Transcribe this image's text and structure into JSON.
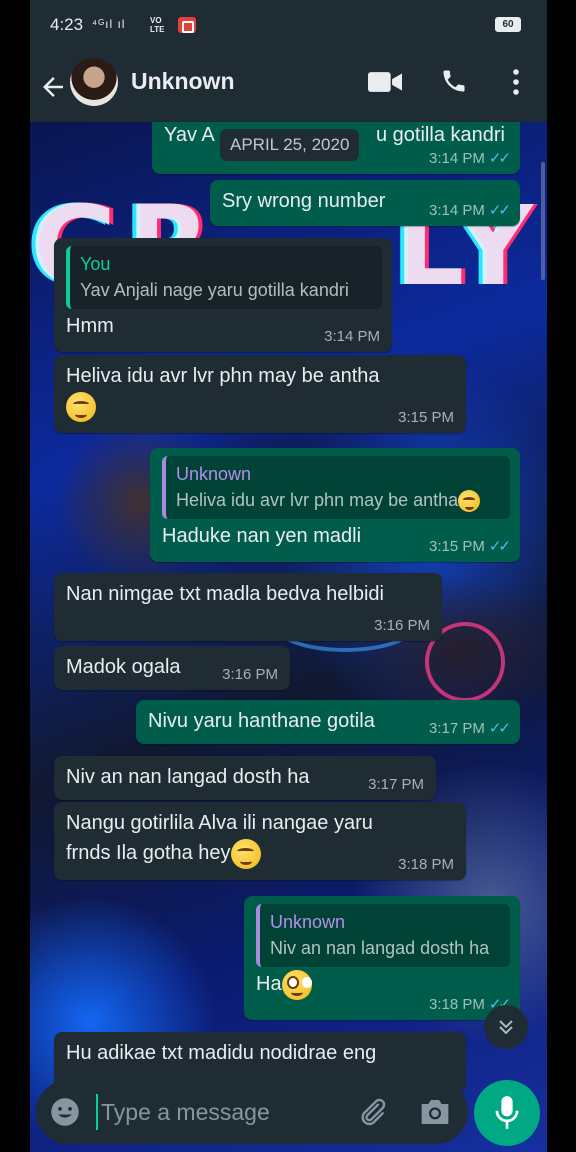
{
  "status_bar": {
    "time": "4:23",
    "signal": "⁴ᴳıl ıl",
    "network_badge": "VO\nLTE",
    "battery": "60"
  },
  "header": {
    "contact_name": "Unknown"
  },
  "chat": {
    "date_chip": "APRIL 25, 2020",
    "messages": [
      {
        "text": "Yav A",
        "text_tail": "u gotilla kandri",
        "time": "3:14 PM"
      },
      {
        "text": "Sry wrong number",
        "time": "3:14 PM"
      },
      {
        "quote_name": "You",
        "quote_text": "Yav Anjali nage yaru gotilla kandri",
        "text": "Hmm",
        "time": "3:14 PM"
      },
      {
        "text": "Heliva idu avr lvr phn may be antha",
        "time": "3:15 PM"
      },
      {
        "quote_name": "Unknown",
        "quote_text": "Heliva idu avr lvr phn may be antha",
        "text": "Haduke nan yen madli",
        "time": "3:15 PM"
      },
      {
        "text": "Nan nimgae txt madla bedva helbidi",
        "time": "3:16 PM"
      },
      {
        "text": "Madok ogala",
        "time": "3:16 PM"
      },
      {
        "text": "Nivu yaru hanthane gotila",
        "time": "3:17 PM"
      },
      {
        "text": "Niv an nan langad dosth ha",
        "time": "3:17 PM"
      },
      {
        "text": "Nangu gotirlila Alva ili nangae yaru",
        "text_line2": "frnds Ila gotha hey",
        "time": "3:18 PM"
      },
      {
        "quote_name": "Unknown",
        "quote_text": "Niv an nan langad dosth ha",
        "text": "Ha",
        "time": "3:18 PM"
      },
      {
        "text": "Hu adikae txt madidu nodidrae eng"
      }
    ]
  },
  "composer": {
    "placeholder": "Type a message"
  },
  "colors": {
    "incoming": "#1f2c34",
    "outgoing": "#005c4b",
    "accent": "#00a884",
    "read_ticks": "#53bdeb"
  },
  "icons": [
    "back-arrow-icon",
    "video-call-icon",
    "phone-icon",
    "more-vert-icon",
    "emoji-icon",
    "attach-icon",
    "camera-icon",
    "mic-icon",
    "double-chevron-down-icon"
  ]
}
